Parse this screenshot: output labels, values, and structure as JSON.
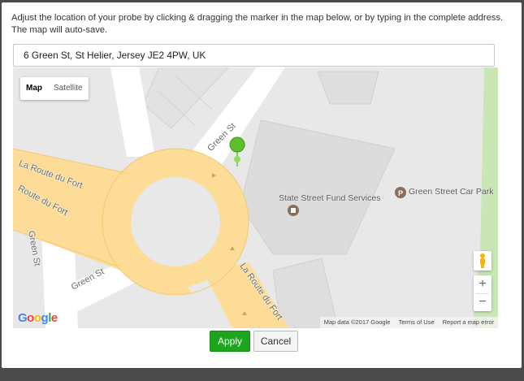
{
  "dialog": {
    "instructions": "Adjust the location of your probe by clicking & dragging the marker in the map below, or by typing in the complete address. The map will auto-save.",
    "address_value": "6 Green St, St Helier, Jersey JE2 4PW, UK",
    "apply_label": "Apply",
    "cancel_label": "Cancel"
  },
  "map": {
    "type_options": [
      "Map",
      "Satellite"
    ],
    "selected_type": "Map",
    "street_labels": {
      "la_route_du_fort_1": "La Route du Fort",
      "route_du_fort": "Route du Fort",
      "green_st_1": "Green St",
      "green_st_2": "Green St",
      "green_st_3": "Green St",
      "la_route_du_fort_2": "La Route du Fort"
    },
    "pois": {
      "state_street": "State Street Fund Services",
      "car_park": "Green Street Car Park"
    },
    "zoom_in": "+",
    "zoom_out": "−",
    "footer": {
      "map_data": "Map data ©2017 Google",
      "terms": "Terms of Use",
      "report": "Report a map error"
    },
    "logo": "Google",
    "marker_color": "#5fbf2a"
  },
  "colors": {
    "apply_green": "#1ea51e",
    "road_yellow": "#fcdc97",
    "park_green": "#c9e6b4"
  }
}
